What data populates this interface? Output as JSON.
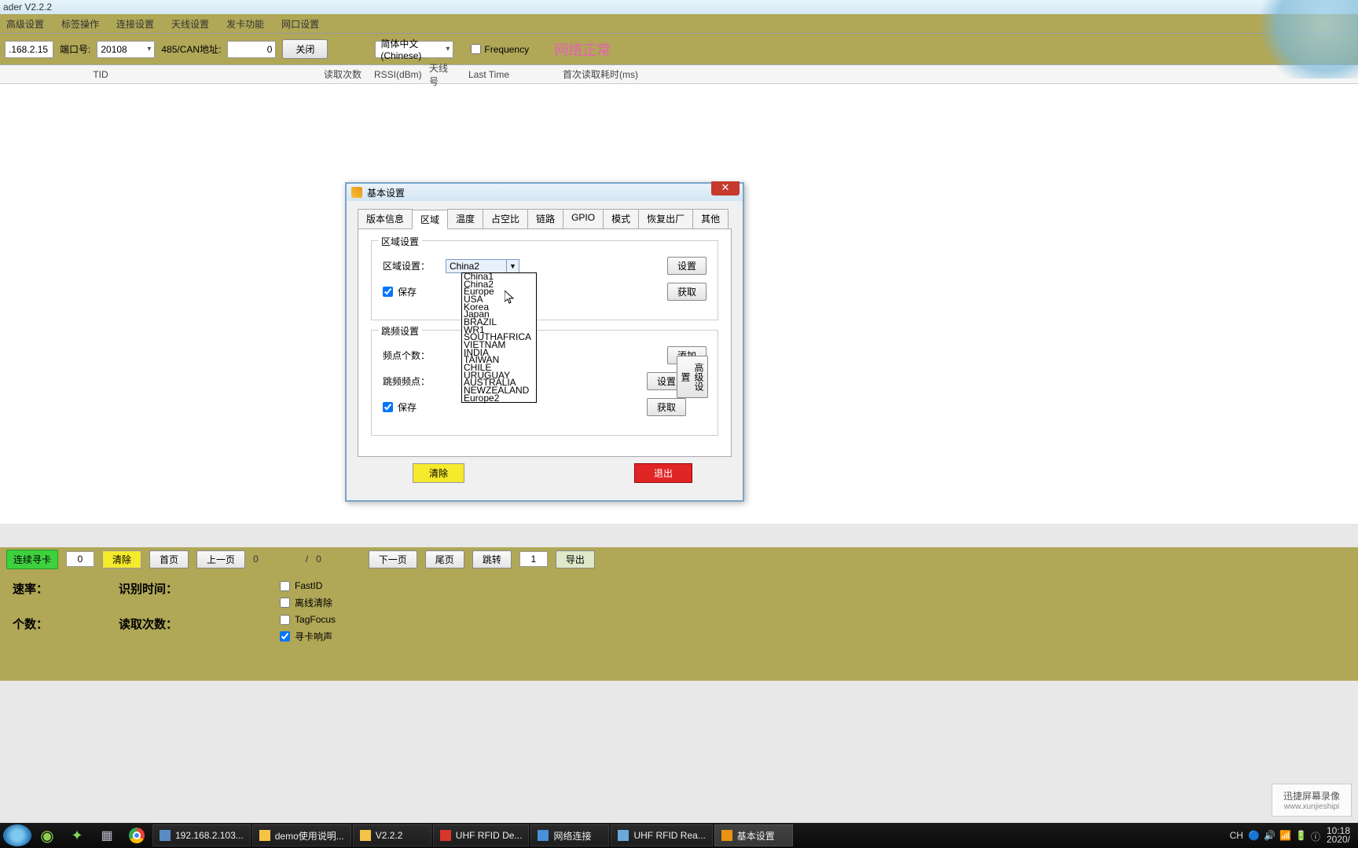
{
  "app": {
    "title": "ader V2.2.2"
  },
  "menu": {
    "advanced": "高级设置",
    "tag_ops": "标签操作",
    "conn": "连接设置",
    "antenna": "天线设置",
    "card": "发卡功能",
    "netport": "网口设置"
  },
  "toolbar": {
    "ip": ".168.2.15",
    "port_label": "端口号:",
    "port": "20108",
    "addr_label": "485/CAN地址:",
    "addr": "0",
    "close": "关闭",
    "lang": "简体中文(Chinese)",
    "frequency": "Frequency",
    "net_status": "网络正常"
  },
  "table": {
    "col1": "TID",
    "col2": "读取次数",
    "col3": "RSSI(dBm)",
    "col4": "天线号",
    "col5": "Last Time",
    "col6": "首次读取耗时(ms)"
  },
  "dialog": {
    "title": "基本设置",
    "tabs": {
      "version": "版本信息",
      "region": "区域",
      "temp": "温度",
      "duty": "占空比",
      "link": "链路",
      "gpio": "GPIO",
      "mode": "模式",
      "restore": "恢复出厂",
      "other": "其他"
    },
    "region": {
      "group": "区域设置",
      "label": "区域设置：",
      "value": "China2",
      "save": "保存",
      "set": "设置",
      "get": "获取",
      "options": [
        "China1",
        "China2",
        "Europe",
        "USA",
        "Korea",
        "Japan",
        "BRAZIL",
        "WR1",
        "SOUTHAFRICA",
        "VIETNAM",
        "INDIA",
        "TAIWAN",
        "CHILE",
        "URUGUAY",
        "AUSTRALIA",
        "NEWZEALAND",
        "Europe2"
      ]
    },
    "hop": {
      "group": "跳频设置",
      "points_label": "频点个数：",
      "freq_label": "跳频频点：",
      "save": "保存",
      "add": "添加",
      "set": "设置",
      "get": "获取",
      "adv": "高级设置"
    },
    "clear": "清除",
    "exit": "退出"
  },
  "paging": {
    "scan": "连续寻卡",
    "scan_count": "0",
    "clear": "清除",
    "first": "首页",
    "prev": "上一页",
    "cur": "0",
    "sep": "/",
    "total": "0",
    "next": "下一页",
    "last": "尾页",
    "jump": "跳转",
    "jump_to": "1",
    "export": "导出"
  },
  "status": {
    "rate": "速率：",
    "count": "个数：",
    "id_time": "识别时间：",
    "read_count": "读取次数：",
    "fastid": "FastID",
    "offline_clear": "离线清除",
    "tagfocus": "TagFocus",
    "beep": "寻卡响声"
  },
  "watermark": {
    "text": "迅捷屏幕录像",
    "sub": "www.xunjieshipi"
  },
  "taskbar": {
    "items": [
      "192.168.2.103...",
      "demo使用说明...",
      "V2.2.2",
      "UHF RFID De...",
      "网络连接",
      "UHF RFID Rea...",
      "基本设置"
    ],
    "lang": "CH",
    "time": "10:18",
    "date": "2020/"
  }
}
